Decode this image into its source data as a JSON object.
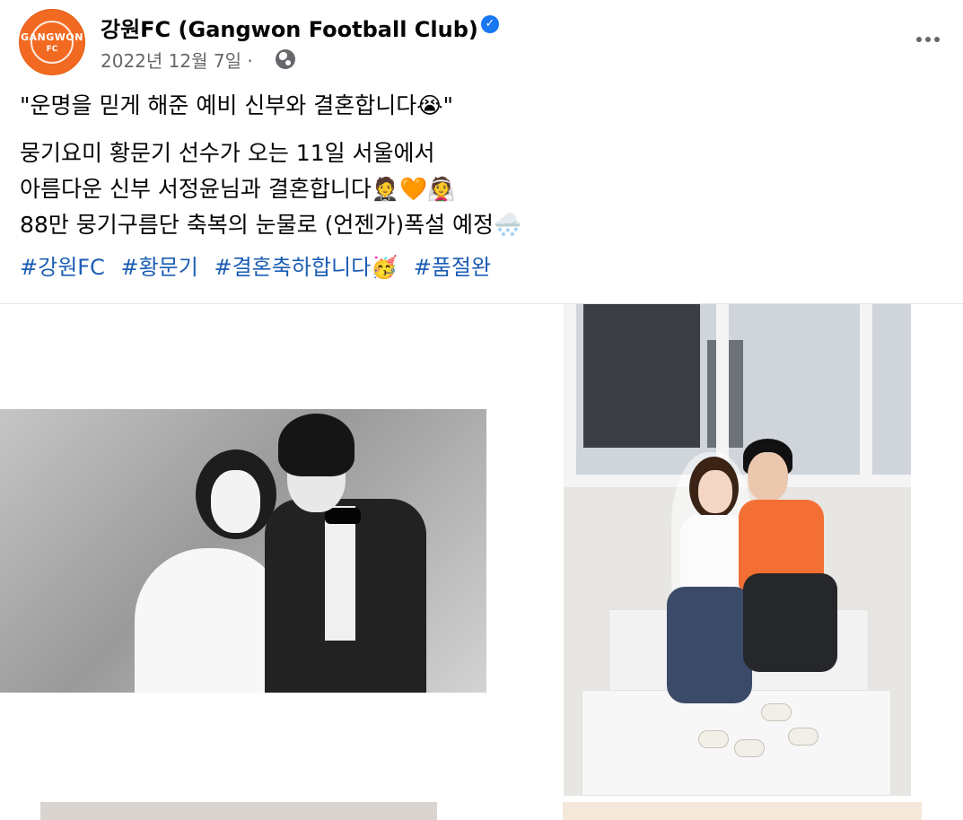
{
  "header": {
    "page_name": "강원FC (Gangwon Football Club)",
    "verified_icon": "verified-badge-icon",
    "date": "2022년 12월 7일 ·",
    "audience_icon": "globe-icon",
    "avatar_text": "GANGWON",
    "avatar_sub": "FC",
    "more_icon": "more-options-icon"
  },
  "post": {
    "line1": "\"운명을 믿게 해준 예비 신부와 결혼합니다😭\"",
    "line2": "뭉기요미 황문기 선수가 오는 11일 서울에서",
    "line3": "아름다운 신부 서정윤님과 결혼합니다🤵🧡👰",
    "line4": "88만 뭉기구름단 축복의 눈물로 (언젠가)폭설 예정🌨️",
    "hashtags": [
      "#강원FC",
      "#황문기",
      "#결혼축하합니다🥳",
      "#품절완"
    ]
  },
  "colors": {
    "brand_orange": "#f26a21",
    "link_blue": "#1b5db4",
    "meta_gray": "#65676b",
    "verified_blue": "#1877f2"
  }
}
